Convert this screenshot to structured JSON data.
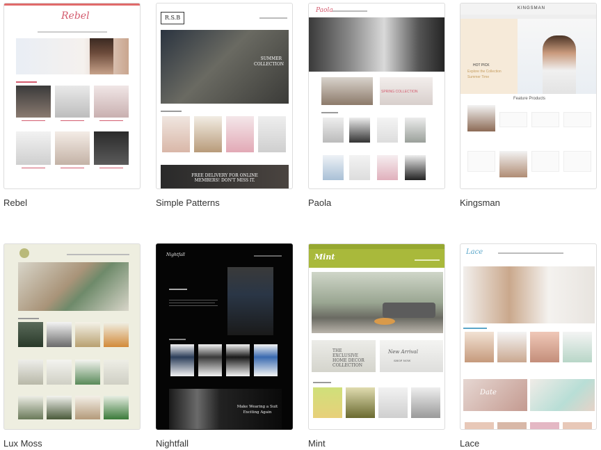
{
  "themes": [
    {
      "name": "Rebel"
    },
    {
      "name": "Simple Patterns"
    },
    {
      "name": "Paola"
    },
    {
      "name": "Kingsman"
    },
    {
      "name": "Lux Moss"
    },
    {
      "name": "Nightfall"
    },
    {
      "name": "Mint"
    },
    {
      "name": "Lace"
    }
  ],
  "previews": {
    "rebel": {
      "logo": "Rebel"
    },
    "simple_patterns": {
      "logo": "R.S.B",
      "hero_text": "SUMMER COLLECTION",
      "banner_text": "FREE DELIVERY FOR ONLINE MEMBERS! DON'T MISS IT."
    },
    "paola": {
      "logo": "Paola",
      "collection": "SPRING COLLECTION"
    },
    "kingsman": {
      "logo": "KINGSMAN",
      "hot_pick": "HOT PICK",
      "explore": "Explore the Collection",
      "summer": "Summer Time",
      "featured": "Feature Products"
    },
    "nightfall": {
      "logo": "Nightfall",
      "tagline": "Make Wearing a Suit Exciting Again"
    },
    "mint": {
      "logo": "Mint",
      "decor": "THE EXCLUSIVE HOME DECOR COLLECTION",
      "arrival": "New Arrival",
      "shop": "SHOP NOW"
    },
    "lace": {
      "logo": "Lace",
      "date": "Date"
    }
  },
  "colors": {
    "accent_red": "#d35b6e",
    "mint_green": "#a9b93b",
    "lace_blue": "#5aa6c9"
  }
}
